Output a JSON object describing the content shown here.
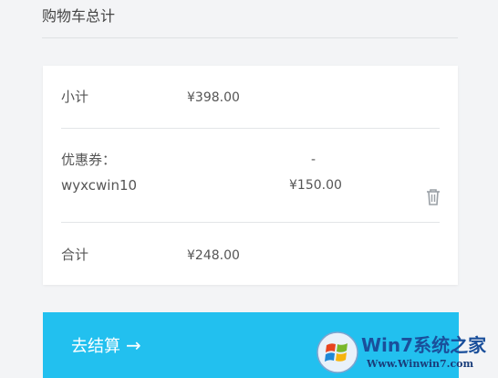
{
  "header": {
    "title": "购物车总计"
  },
  "summary": {
    "subtotal_label": "小计",
    "subtotal_value": "¥398.00",
    "coupon_label": "优惠券：",
    "coupon_code": "wyxcwin10",
    "coupon_dash": "-",
    "coupon_value": "¥150.00",
    "total_label": "合计",
    "total_value": "¥248.00"
  },
  "checkout": {
    "label": "去结算",
    "arrow": "→"
  },
  "watermark": {
    "brand": "Win7系统之家",
    "url": "Www.Winwin7.com"
  },
  "colors": {
    "accent": "#22c0ef",
    "page_background": "#f3f4f6",
    "card_background": "#ffffff"
  },
  "icons": {
    "remove_coupon": "trash-icon"
  }
}
